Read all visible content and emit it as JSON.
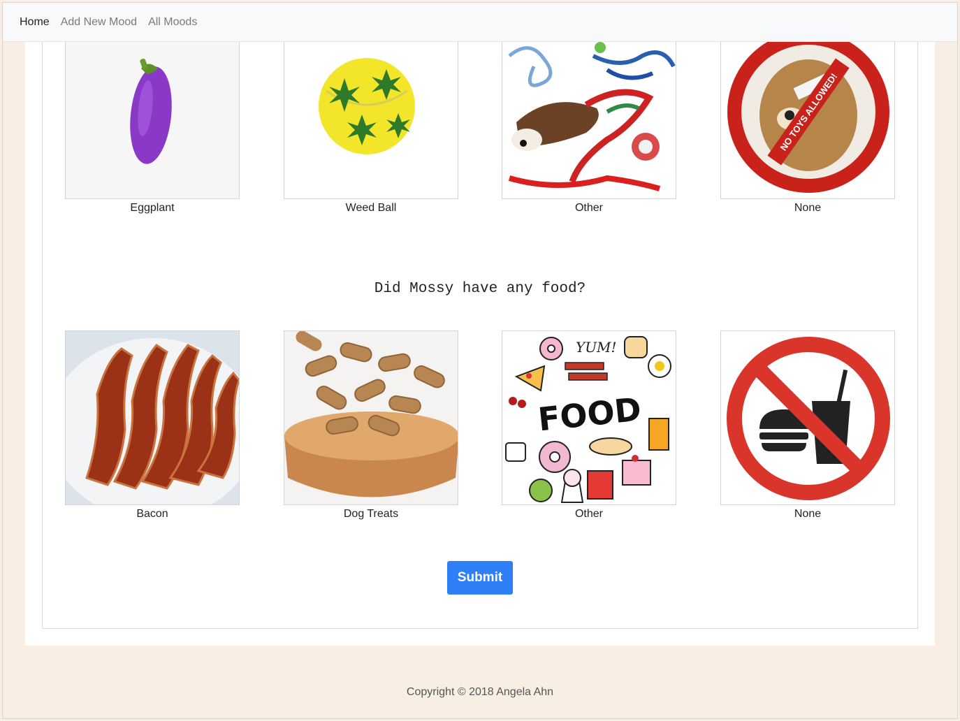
{
  "nav": {
    "items": [
      {
        "label": "Home",
        "active": true
      },
      {
        "label": "Add New Mood",
        "active": false
      },
      {
        "label": "All Moods",
        "active": false
      }
    ]
  },
  "toys": {
    "options": [
      {
        "label": "Eggplant",
        "image": "purple-eggplant-plush-toy"
      },
      {
        "label": "Weed Ball",
        "image": "yellow-leaf-ball-toy"
      },
      {
        "label": "Other",
        "image": "assorted-rope-and-plush-toys"
      },
      {
        "label": "None",
        "image": "no-toys-allowed-teddy-bear",
        "stamp_text": "NO TOYS ALLOWED!"
      }
    ]
  },
  "food": {
    "question": "Did Mossy have any food?",
    "options": [
      {
        "label": "Bacon",
        "image": "plate-of-bacon"
      },
      {
        "label": "Dog Treats",
        "image": "bowl-of-bone-treats"
      },
      {
        "label": "Other",
        "image": "food-doodle-collage",
        "image_text": "FOOD",
        "image_text_2": "YUM!"
      },
      {
        "label": "None",
        "image": "no-food-prohibition-sign"
      }
    ]
  },
  "submit_label": "Submit",
  "footer": "Copyright © 2018 Angela Ahn",
  "colors": {
    "accent": "#2f80f6",
    "page_bg": "#f9eee4",
    "navbar_bg": "#f8f9fa",
    "prohibit_red": "#c8221b"
  }
}
